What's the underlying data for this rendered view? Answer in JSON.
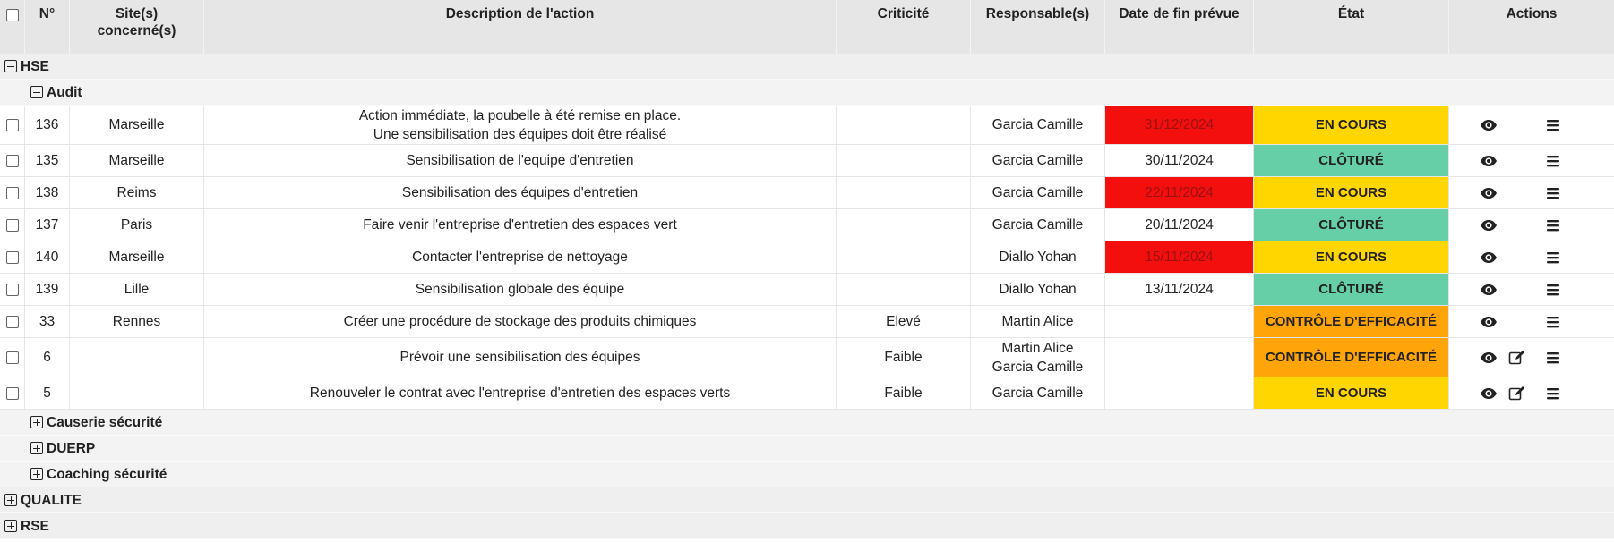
{
  "columns": {
    "number": "N°",
    "site": "Site(s) concerné(s)",
    "site_line1": "Site(s)",
    "site_line2": "concerné(s)",
    "description": "Description de l'action",
    "criticite": "Criticité",
    "responsable": "Responsable(s)",
    "date": "Date de fin prévue",
    "etat": "État",
    "actions": "Actions"
  },
  "groups": [
    {
      "label": "HSE",
      "expanded": true,
      "subgroups": [
        {
          "label": "Audit",
          "expanded": true,
          "rows": [
            {
              "num": "136",
              "site": "Marseille",
              "description": [
                "Action immédiate, la poubelle à été remise en place.",
                "Une sensibilisation des équipes doit être réalisé"
              ],
              "criticite": "",
              "responsables": [
                "Garcia Camille"
              ],
              "date": "31/12/2024",
              "date_late": true,
              "etat": "EN COURS",
              "etat_style": "cours",
              "editable": false
            },
            {
              "num": "135",
              "site": "Marseille",
              "description": [
                "Sensibilisation de l'equipe d'entretien"
              ],
              "criticite": "",
              "responsables": [
                "Garcia Camille"
              ],
              "date": "30/11/2024",
              "date_late": false,
              "etat": "CLÔTURÉ",
              "etat_style": "cloture",
              "editable": false
            },
            {
              "num": "138",
              "site": "Reims",
              "description": [
                "Sensibilisation des équipes d'entretien"
              ],
              "criticite": "",
              "responsables": [
                "Garcia Camille"
              ],
              "date": "22/11/2024",
              "date_late": true,
              "etat": "EN COURS",
              "etat_style": "cours",
              "editable": false
            },
            {
              "num": "137",
              "site": "Paris",
              "description": [
                "Faire venir l'entreprise d'entretien des espaces vert"
              ],
              "criticite": "",
              "responsables": [
                "Garcia Camille"
              ],
              "date": "20/11/2024",
              "date_late": false,
              "etat": "CLÔTURÉ",
              "etat_style": "cloture",
              "editable": false
            },
            {
              "num": "140",
              "site": "Marseille",
              "description": [
                "Contacter l'entreprise de nettoyage"
              ],
              "criticite": "",
              "responsables": [
                "Diallo Yohan"
              ],
              "date": "15/11/2024",
              "date_late": true,
              "etat": "EN COURS",
              "etat_style": "cours",
              "editable": false
            },
            {
              "num": "139",
              "site": "Lille",
              "description": [
                "Sensibilisation globale des équipe"
              ],
              "criticite": "",
              "responsables": [
                "Diallo Yohan"
              ],
              "date": "13/11/2024",
              "date_late": false,
              "etat": "CLÔTURÉ",
              "etat_style": "cloture",
              "editable": false
            },
            {
              "num": "33",
              "site": "Rennes",
              "description": [
                "Créer une procédure de stockage des produits chimiques"
              ],
              "criticite": "Elevé",
              "responsables": [
                "Martin Alice"
              ],
              "date": "",
              "date_late": false,
              "etat": "CONTRÔLE D'EFFICACITÉ",
              "etat_style": "controle",
              "editable": false
            },
            {
              "num": "6",
              "site": "",
              "description": [
                "Prévoir une sensibilisation des équipes"
              ],
              "criticite": "Faible",
              "responsables": [
                "Martin Alice",
                "Garcia Camille"
              ],
              "date": "",
              "date_late": false,
              "etat": "CONTRÔLE D'EFFICACITÉ",
              "etat_style": "controle",
              "editable": true
            },
            {
              "num": "5",
              "site": "",
              "description": [
                "Renouveler le contrat avec l'entreprise d'entretien des espaces verts"
              ],
              "criticite": "Faible",
              "responsables": [
                "Garcia Camille"
              ],
              "date": "",
              "date_late": false,
              "etat": "EN COURS",
              "etat_style": "cours",
              "editable": true
            }
          ]
        },
        {
          "label": "Causerie sécurité",
          "expanded": false
        },
        {
          "label": "DUERP",
          "expanded": false
        },
        {
          "label": "Coaching sécurité",
          "expanded": false
        }
      ]
    },
    {
      "label": "QUALITE",
      "expanded": false
    },
    {
      "label": "RSE",
      "expanded": false
    }
  ],
  "icons": {
    "view": "eye-icon",
    "edit": "edit-icon",
    "menu": "hamburger-menu-icon",
    "expand": "plus-square-icon",
    "collapse": "minus-square-icon"
  },
  "colors": {
    "date_late": "#f40f0f",
    "etat_en_cours": "#ffd600",
    "etat_cloture": "#66cfa8",
    "etat_controle": "#ffa50a",
    "header_bg": "#e6e6e6"
  }
}
